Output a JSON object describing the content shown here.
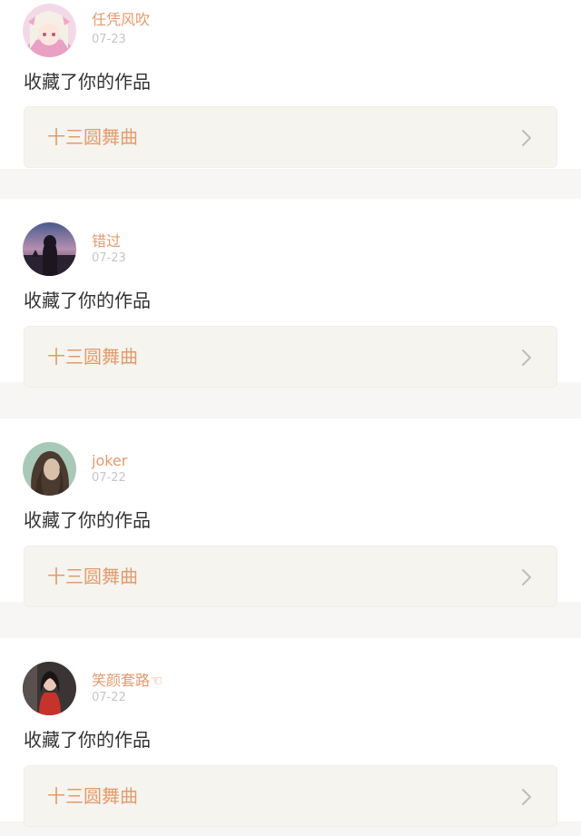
{
  "feed": {
    "items": [
      {
        "username": "任凭风吹",
        "date": "07-23",
        "action": "收藏了你的作品",
        "work_title": "十三圆舞曲",
        "chevron_icon": "chevron-right-icon",
        "avatar_icon": "anime-girl-avatar"
      },
      {
        "username": "错过",
        "date": "07-23",
        "action": "收藏了你的作品",
        "work_title": "十三圆舞曲",
        "chevron_icon": "chevron-right-icon",
        "avatar_icon": "sunset-silhouette-avatar"
      },
      {
        "username": "joker",
        "date": "07-22",
        "action": "收藏了你的作品",
        "work_title": "十三圆舞曲",
        "chevron_icon": "chevron-right-icon",
        "avatar_icon": "dark-hair-portrait-avatar"
      },
      {
        "username": "笑颜套路☜",
        "date": "07-22",
        "action": "收藏了你的作品",
        "work_title": "十三圆舞曲",
        "chevron_icon": "chevron-right-icon",
        "avatar_icon": "red-dress-portrait-avatar"
      }
    ]
  },
  "colors": {
    "username": "#e49a6d",
    "work_title": "#e49a6d",
    "date": "#c6c6c6",
    "action_text": "#333333",
    "card_background": "#ffffff",
    "separator": "#f7f6f4",
    "work_box_background": "#f5f4ee",
    "chevron": "#bdbdbd"
  }
}
